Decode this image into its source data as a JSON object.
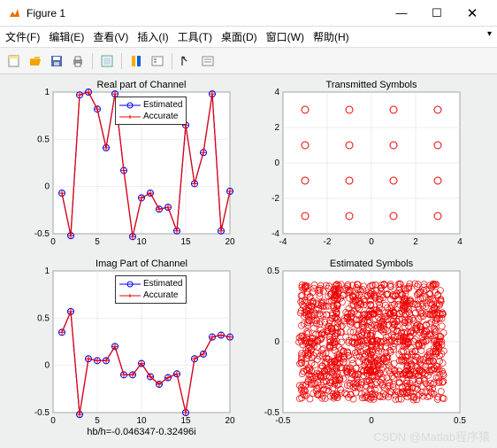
{
  "window": {
    "title": "Figure 1"
  },
  "menu": {
    "file": "文件(F)",
    "edit": "编辑(E)",
    "view": "查看(V)",
    "insert": "插入(I)",
    "tools": "工具(T)",
    "desktop": "桌面(D)",
    "window": "窗口(W)",
    "help": "帮助(H)"
  },
  "legend": {
    "estimated": "Estimated",
    "accurate": "Accurate"
  },
  "xlabel_bottom": "hb/h=-0.046347-0.32496i",
  "watermark": "CSDN @Matlab程序猿",
  "chart_data": [
    {
      "title": "Real part of Channel",
      "type": "line",
      "xlim": [
        0,
        20
      ],
      "ylim": [
        -0.5,
        1
      ],
      "xticks": [
        0,
        5,
        10,
        15,
        20
      ],
      "yticks": [
        -0.5,
        0,
        0.5,
        1
      ],
      "x": [
        1,
        2,
        3,
        4,
        5,
        6,
        7,
        8,
        9,
        10,
        11,
        12,
        13,
        14,
        15,
        16,
        17,
        18,
        19,
        20
      ],
      "series": [
        {
          "name": "Estimated",
          "style": "blue-circle",
          "values": [
            -0.07,
            -0.52,
            0.97,
            1.0,
            0.82,
            0.41,
            0.98,
            0.17,
            -0.53,
            -0.12,
            -0.07,
            -0.24,
            -0.22,
            -0.47,
            0.65,
            0.03,
            0.36,
            0.98,
            -0.47,
            -0.05
          ]
        },
        {
          "name": "Accurate",
          "style": "red-plus",
          "values": [
            -0.07,
            -0.52,
            0.97,
            1.0,
            0.82,
            0.41,
            0.98,
            0.17,
            -0.53,
            -0.12,
            -0.07,
            -0.24,
            -0.22,
            -0.47,
            0.65,
            0.03,
            0.36,
            0.98,
            -0.47,
            -0.05
          ]
        }
      ]
    },
    {
      "title": "Transmitted Symbols",
      "type": "scatter",
      "xlim": [
        -4,
        4
      ],
      "ylim": [
        -4,
        4
      ],
      "xticks": [
        -4,
        -2,
        0,
        2,
        4
      ],
      "yticks": [
        -4,
        -2,
        0,
        2,
        4
      ],
      "points_x": [
        -3,
        -1,
        1,
        3,
        -3,
        -1,
        1,
        3,
        -3,
        -1,
        1,
        3,
        -3,
        -1,
        1,
        3
      ],
      "points_y": [
        3,
        3,
        3,
        3,
        1,
        1,
        1,
        1,
        -1,
        -1,
        -1,
        -1,
        -3,
        -3,
        -3,
        -3
      ]
    },
    {
      "title": "Imag Part of Channel",
      "type": "line",
      "xlim": [
        0,
        20
      ],
      "ylim": [
        -0.5,
        1
      ],
      "xticks": [
        0,
        5,
        10,
        15,
        20
      ],
      "yticks": [
        -0.5,
        0,
        0.5,
        1
      ],
      "x": [
        1,
        2,
        3,
        4,
        5,
        6,
        7,
        8,
        9,
        10,
        11,
        12,
        13,
        14,
        15,
        16,
        17,
        18,
        19,
        20
      ],
      "series": [
        {
          "name": "Estimated",
          "style": "blue-circle",
          "values": [
            0.35,
            0.57,
            -0.52,
            0.07,
            0.05,
            0.05,
            0.2,
            -0.1,
            -0.1,
            0.02,
            -0.12,
            -0.2,
            -0.13,
            -0.09,
            -0.5,
            0.07,
            0.12,
            0.3,
            0.32,
            0.3
          ]
        },
        {
          "name": "Accurate",
          "style": "red-plus",
          "values": [
            0.35,
            0.57,
            -0.52,
            0.07,
            0.05,
            0.05,
            0.2,
            -0.1,
            -0.1,
            0.02,
            -0.12,
            -0.2,
            -0.13,
            -0.09,
            -0.5,
            0.07,
            0.12,
            0.3,
            0.32,
            0.3
          ]
        }
      ]
    },
    {
      "title": "Estimated Symbols",
      "type": "scatter-dense",
      "xlim": [
        -0.5,
        0.5
      ],
      "ylim": [
        -0.5,
        0.5
      ],
      "xticks": [
        -0.5,
        0,
        0.5
      ],
      "yticks": [
        -0.5,
        0,
        0.5
      ],
      "clusters_x": [
        -0.3,
        -0.1,
        0.1,
        0.3
      ],
      "clusters_y": [
        -0.3,
        -0.1,
        0.1,
        0.3
      ],
      "spread": 0.11,
      "n_per_cluster": 80
    }
  ]
}
